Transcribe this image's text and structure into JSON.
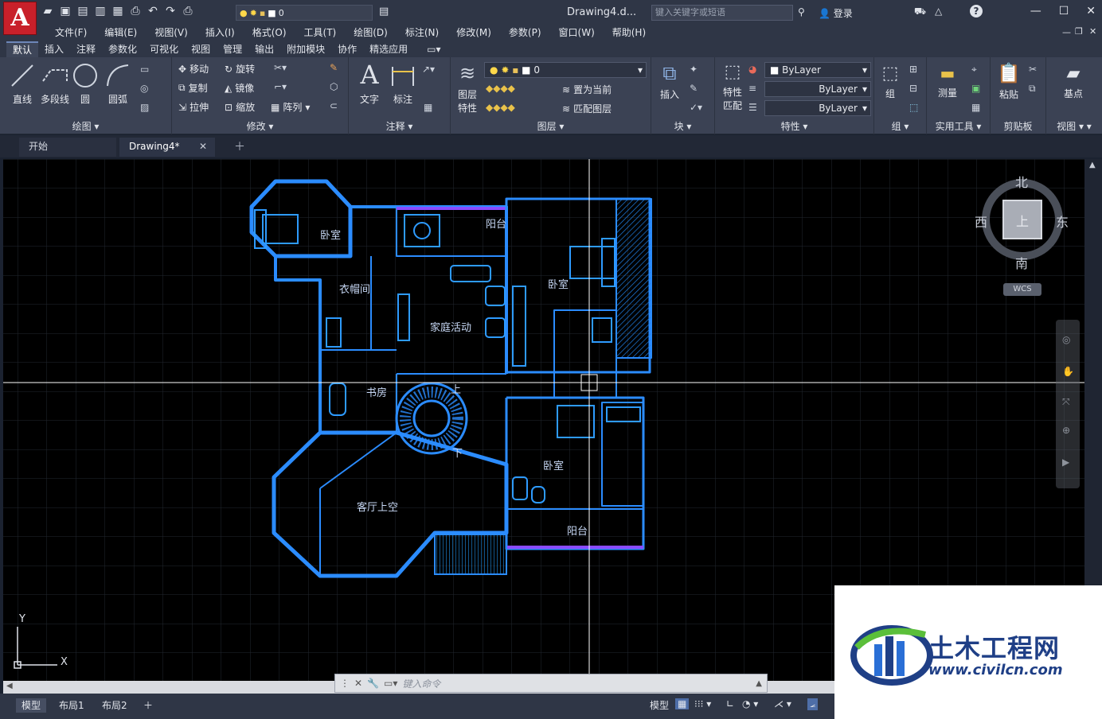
{
  "app": {
    "logo_letter": "A",
    "document_title": "Drawing4.d...",
    "login_label": "登录",
    "search_placeholder": "键入关键字或短语"
  },
  "layer_mini_value": "0",
  "menu": [
    "文件(F)",
    "编辑(E)",
    "视图(V)",
    "插入(I)",
    "格式(O)",
    "工具(T)",
    "绘图(D)",
    "标注(N)",
    "修改(M)",
    "参数(P)",
    "窗口(W)",
    "帮助(H)"
  ],
  "ribbon_tabs": [
    "默认",
    "插入",
    "注释",
    "参数化",
    "可视化",
    "视图",
    "管理",
    "输出",
    "附加模块",
    "协作",
    "精选应用"
  ],
  "ribbon": {
    "draw": {
      "title": "绘图",
      "line": "直线",
      "polyline": "多段线",
      "circle": "圆",
      "arc": "圆弧"
    },
    "modify": {
      "title": "修改",
      "move": "移动",
      "rotate": "旋转",
      "copy": "复制",
      "mirror": "镜像",
      "stretch": "拉伸",
      "scale": "缩放",
      "array": "阵列"
    },
    "annotation": {
      "title": "注释",
      "text": "文字",
      "dimension": "标注"
    },
    "layers": {
      "title": "图层",
      "layer_props_1": "图层",
      "layer_props_2": "特性",
      "layer_value": "0",
      "set_current": "置为当前",
      "match_layer": "匹配图层"
    },
    "block": {
      "title": "块",
      "insert": "插入"
    },
    "properties": {
      "title": "特性",
      "match_1": "特性",
      "match_2": "匹配",
      "color": "ByLayer",
      "linetype": "ByLayer",
      "lineweight": "ByLayer"
    },
    "groups": {
      "title": "组",
      "group": "组"
    },
    "utilities": {
      "title": "实用工具",
      "measure": "测量"
    },
    "clipboard": {
      "title": "剪贴板",
      "paste": "粘贴"
    },
    "view": {
      "title": "视图",
      "base": "基点"
    }
  },
  "doc_tabs": {
    "start": "开始",
    "drawing": "Drawing4*"
  },
  "plan_labels": {
    "bedroom_nw": "卧室",
    "balcony_n": "阳台",
    "cloakroom": "衣帽间",
    "family": "家庭活动",
    "bedroom_ne": "卧室",
    "study": "书房",
    "up": "上",
    "down": "下",
    "bedroom_se": "卧室",
    "living_void": "客厅上空",
    "balcony_s": "阳台"
  },
  "viewcube": {
    "north": "北",
    "south": "南",
    "east": "东",
    "west": "西",
    "top": "上",
    "wcs": "WCS"
  },
  "ucs": {
    "x": "X",
    "y": "Y"
  },
  "command_placeholder": "键入命令",
  "status_tabs": [
    "模型",
    "布局1",
    "布局2"
  ],
  "status_model_button": "模型",
  "watermark": {
    "title": "土木工程网",
    "url": "www.civilcn.com"
  }
}
